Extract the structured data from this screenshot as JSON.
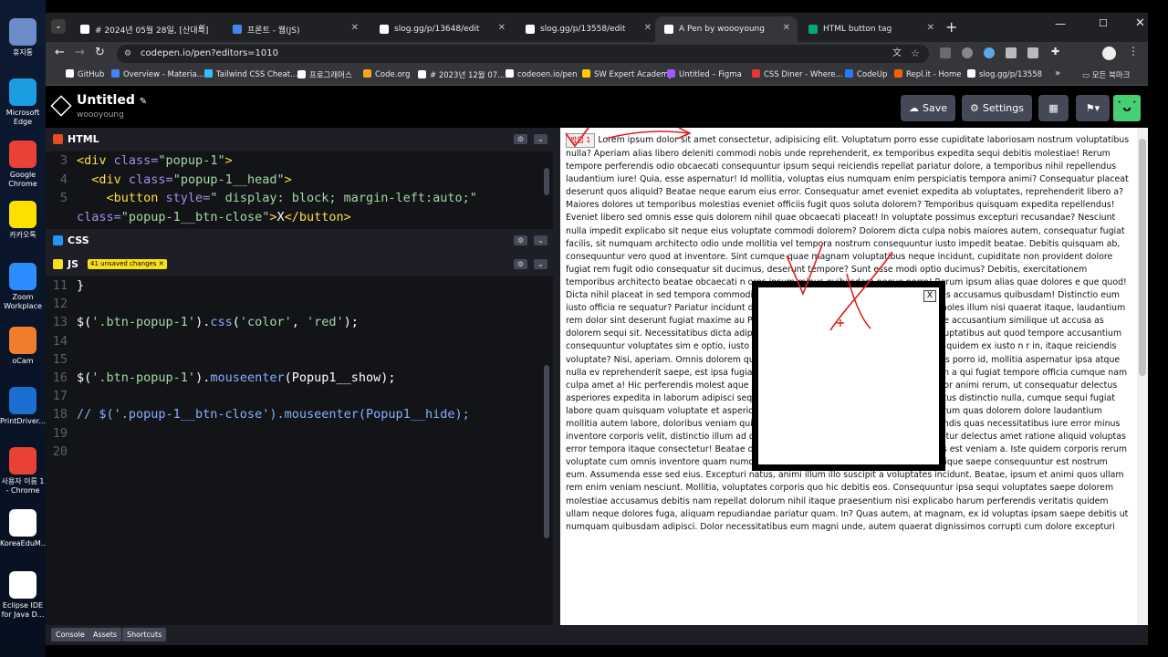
{
  "desktop": {
    "icons": [
      {
        "label": "휴지통",
        "icon": "recycle-bin-icon",
        "color": "#6a8cc9"
      },
      {
        "label": "Microsoft Edge",
        "icon": "edge-icon",
        "color": "#1b9de2"
      },
      {
        "label": "Google Chrome",
        "icon": "chrome-icon",
        "color": "#e94235"
      },
      {
        "label": "카카오톡",
        "icon": "kakaotalk-icon",
        "color": "#fae100"
      },
      {
        "label": "Zoom Workplace",
        "icon": "zoom-icon",
        "color": "#2d8cff"
      },
      {
        "label": "oCam",
        "icon": "ocam-icon",
        "color": "#ef7d2d"
      },
      {
        "label": "PrintDriver...",
        "icon": "print-driver-icon",
        "color": "#1a6fd1"
      },
      {
        "label": "사용자 이름 1 - Chrome",
        "icon": "chrome-profile-icon",
        "color": "#e94235"
      },
      {
        "label": "KoreaEduM...",
        "icon": "koreaedu-icon",
        "color": "#ffffff"
      },
      {
        "label": "Eclipse IDE for Java D...",
        "icon": "file-icon",
        "color": "#ffffff"
      }
    ]
  },
  "browser": {
    "tabs": [
      {
        "label": "# 2024년 05월 28일, [산대특]",
        "icon": "notion-icon"
      },
      {
        "label": "프론트 - 웹(JS)",
        "icon": "doc-icon"
      },
      {
        "label": "slog.gg/p/13648/edit",
        "icon": "notion-icon"
      },
      {
        "label": "slog.gg/p/13558/edit",
        "icon": "notion-icon"
      },
      {
        "label": "A Pen by woooyoung",
        "icon": "codepen-icon"
      },
      {
        "label": "HTML button tag",
        "icon": "w3-icon"
      }
    ],
    "url": "codepen.io/pen?editors=1010",
    "bookmarks": [
      "GitHub",
      "Overview - Materia...",
      "Tailwind CSS Cheat...",
      "프로그래머스",
      "Code.org",
      "# 2023년 12월 07...",
      "codeoen.io/pen",
      "SW Expert Academy",
      "Untitled – Figma",
      "CSS Diner - Where...",
      "CodeUp",
      "Repl.it - Home",
      "slog.gg/p/13558"
    ],
    "bookmarks_more": "»",
    "all_bookmarks": "모든 북마크"
  },
  "codepen": {
    "title": "Untitled",
    "author": "woooyoung",
    "save_label": "Save",
    "settings_label": "Settings",
    "html_label": "HTML",
    "css_label": "CSS",
    "js_label": "JS",
    "unsaved_badge": "41 unsaved changes",
    "html_code": [
      {
        "n": "3",
        "parts": [
          {
            "t": "<div ",
            "c": "tag"
          },
          {
            "t": "class=",
            "c": "at"
          },
          {
            "t": "\"popup-1\"",
            "c": "st"
          },
          {
            "t": ">",
            "c": "tag"
          }
        ]
      },
      {
        "n": "4",
        "parts": [
          {
            "t": "  <div ",
            "c": "tag"
          },
          {
            "t": "class=",
            "c": "at"
          },
          {
            "t": "\"popup-1__head\"",
            "c": "st"
          },
          {
            "t": ">",
            "c": "tag"
          }
        ]
      },
      {
        "n": "5",
        "parts": [
          {
            "t": "    <button ",
            "c": "tag"
          },
          {
            "t": "style=",
            "c": "at"
          },
          {
            "t": "\" display: block; margin-left:auto;\"",
            "c": "st"
          }
        ]
      },
      {
        "n": "",
        "parts": [
          {
            "t": "class=",
            "c": "at"
          },
          {
            "t": "\"popup-1__btn-close\"",
            "c": "st"
          },
          {
            "t": ">",
            "c": "tag"
          },
          {
            "t": "X",
            "c": "pl"
          },
          {
            "t": "</button>",
            "c": "tag"
          }
        ]
      }
    ],
    "js_code": [
      {
        "n": "11",
        "parts": [
          {
            "t": "}",
            "c": "pl"
          }
        ]
      },
      {
        "n": "12",
        "parts": []
      },
      {
        "n": "13",
        "parts": [
          {
            "t": "$(",
            "c": "pl"
          },
          {
            "t": "'.btn-popup-1'",
            "c": "st"
          },
          {
            "t": ").",
            "c": "pl"
          },
          {
            "t": "css",
            "c": "fn"
          },
          {
            "t": "(",
            "c": "pl"
          },
          {
            "t": "'color'",
            "c": "st"
          },
          {
            "t": ", ",
            "c": "pl"
          },
          {
            "t": "'red'",
            "c": "st"
          },
          {
            "t": ");",
            "c": "pl"
          }
        ]
      },
      {
        "n": "14",
        "parts": []
      },
      {
        "n": "15",
        "parts": []
      },
      {
        "n": "16",
        "parts": [
          {
            "t": "$(",
            "c": "pl"
          },
          {
            "t": "'.btn-popup-1'",
            "c": "st"
          },
          {
            "t": ").",
            "c": "pl"
          },
          {
            "t": "mouseenter",
            "c": "fn"
          },
          {
            "t": "(Popup1__show);",
            "c": "pl"
          }
        ]
      },
      {
        "n": "17",
        "parts": []
      },
      {
        "n": "18",
        "parts": [
          {
            "t": "// $('.popup-1__btn-close').mouseenter(Popup1__hide);",
            "c": "cm"
          }
        ]
      },
      {
        "n": "19",
        "parts": []
      },
      {
        "n": "20",
        "parts": []
      }
    ],
    "preview": {
      "popup_button": "팝업 1",
      "popup_close": "X",
      "lorem": "Lorem ipsum dolor sit amet consectetur, adipisicing elit. Voluptatum porro esse cupiditate laboriosam nostrum voluptatibus nulla? Aperiam alias libero deleniti commodi nobis unde reprehenderit, ex temporibus expedita sequi debitis molestiae! Rerum tempore perferendis odio obcaecati consequuntur ipsum sequi reiciendis repellat pariatur dolore, a temporibus nihil repellendus laudantium iure! Quia, esse aspernatur! Id mollitia, voluptas eius numquam enim perspiciatis tempora animi? Consequatur placeat deserunt quos aliquid? Beatae neque earum eius error. Consequatur amet eveniet expedita ab voluptates, reprehenderit libero a? Maiores dolores ut temporibus molestias eveniet officiis fugit quos soluta dolorem? Temporibus quisquam expedita repellendus! Eveniet libero sed omnis esse quis dolorem nihil quae obcaecati placeat! In voluptate possimus excepturi recusandae? Nesciunt nulla impedit explicabo sit neque eius voluptate commodi dolorem? Dolorem dicta culpa nobis maiores autem, consequatur fugiat facilis, sit numquam architecto odio unde mollitia vel tempora nostrum consequuntur iusto impedit beatae. Debitis quisquam ab, consequuntur vero quod at inventore. Sint cumque quae magnam voluptatibus neque incidunt, cupiditate non provident dolore fugiat rem fugit odio consequatur sit ducimus, deserunt tempore? Sunt esse modi optio ducimus? Debitis, exercitationem temporibus architecto beatae obcaecati n ores ipsum minus quibusdam neque porro! Rerum ipsum alias quae dolores e que quod! Dicta nihil placeat in sed tempora commodi ipsa officiis voluptatum sapiente voluptatibus accusamus quibusdam! Distinctio eum iusto officia re sequatur? Pariatur incidunt deleniti temporibus, accusamus labore vero moles illum nisi quaerat itaque, laudantium rem dolor sint deserunt fugiat maxime au Perferendis dolor earum quo quas ex voluptate accusantium similique ut accusa as dolorem sequi sit. Necessitatibus dicta adipisci omnis debitis quo nesciunt at do ugit voluptatibus aut quod tempore accusantium consequuntur voluptates sim e optio, iusto omnis reprehenderit? Aliquid officia sapiente quidem ex iusto n r in, itaque reiciendis voluptate? Nisi, aperiam. Omnis dolorem quisquam tenet em, temporibus in placeat quos porro id, mollitia aspernatur ipsa atque nulla ev reprehenderit saepe, est ipsa fugiat id laudantium sunt, earum qui possimus con a qui fugiat tempore officia cumque nam culpa amet a! Hic perferendis molest aque iure repellendus necessitatibus obcaecati error animi rerum, ut consequatur delectus asperiores expedita in laborum adipisci sequi? Dolor sit laboriosam sequi. Illum nam, natus distinctio nulla, cumque sequi fugiat labore quam quisquam voluptate et asperiores sit recusandae nemo aliquam autem. Rerum quas dolorem dolore laudantium mollitia autem labore, doloribus veniam qui? Architecto sunt exercitationem quasi reiciendis quas necessitatibus iure error minus inventore corporis velit, distinctio illum ad doloremque hic tempore! Corporis consequuntur delectus amet ratione aliquid voluptas error tempora itaque consectetur! Beatae dolores cumque, similique fugit necessitatibus est veniam a. Iste quidem corporis rerum voluptate cum omnis inventore quam numquam ullam, dolores delectus unde alias similique saepe consequuntur est nostrum eum. Assumenda esse sed eius. Excepturi natus, animi illum illo suscipit a voluptates incidunt. Beatae, ipsum et animi quos ullam rem enim veniam nesciunt. Mollitia, voluptates corporis quo hic debitis eos. Consequuntur ipsa sequi voluptates saepe dolorem molestiae accusamus debitis nam repellat dolorum nihil itaque praesentium nisi explicabo harum perferendis veritatis quidem ullam neque dolores fuga, aliquam repudiandae pariatur quam. In? Quas autem, at magnam, ex id voluptas ipsam saepe debitis ut numquam quibusdam adipisci. Dolor necessitatibus eum magni unde, autem quaerat dignissimos corrupti cum dolore excepturi"
    },
    "bottom": [
      "Console",
      "Assets",
      "Shortcuts"
    ]
  },
  "colors": {
    "annotation": "#e02020",
    "html_badge": "#e44d26",
    "css_badge": "#2196f3",
    "js_badge": "#f7df1e"
  }
}
